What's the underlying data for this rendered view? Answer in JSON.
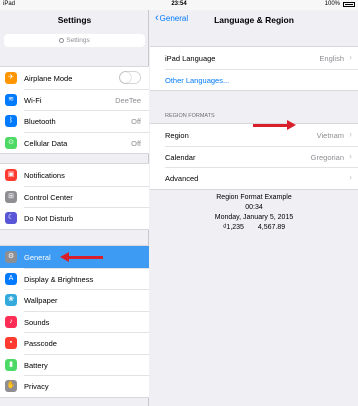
{
  "status": {
    "carrier": "iPad",
    "time": "23:54",
    "battery": "100%"
  },
  "master": {
    "title": "Settings",
    "search_placeholder": "Settings",
    "groups": [
      [
        {
          "label": "Airplane Mode",
          "icon": "airplane-icon",
          "color": "#ff9500",
          "glyph": "✈",
          "value": "",
          "toggle": true
        },
        {
          "label": "Wi-Fi",
          "icon": "wifi-icon",
          "color": "#007aff",
          "glyph": "≋",
          "value": "DeeTee"
        },
        {
          "label": "Bluetooth",
          "icon": "bluetooth-icon",
          "color": "#007aff",
          "glyph": "ᛒ",
          "value": "Off"
        },
        {
          "label": "Cellular Data",
          "icon": "cellular-icon",
          "color": "#4cd964",
          "glyph": "⊙",
          "value": "Off"
        }
      ],
      [
        {
          "label": "Notifications",
          "icon": "notifications-icon",
          "color": "#ff3b30",
          "glyph": "▣",
          "value": ""
        },
        {
          "label": "Control Center",
          "icon": "control-center-icon",
          "color": "#8e8e93",
          "glyph": "⊞",
          "value": ""
        },
        {
          "label": "Do Not Disturb",
          "icon": "moon-icon",
          "color": "#5856d6",
          "glyph": "☾",
          "value": ""
        }
      ],
      [
        {
          "label": "General",
          "icon": "gear-icon",
          "color": "#8e8e93",
          "glyph": "⚙",
          "value": "",
          "selected": true
        },
        {
          "label": "Display & Brightness",
          "icon": "brightness-icon",
          "color": "#007aff",
          "glyph": "A",
          "value": ""
        },
        {
          "label": "Wallpaper",
          "icon": "wallpaper-icon",
          "color": "#34aadc",
          "glyph": "❀",
          "value": ""
        },
        {
          "label": "Sounds",
          "icon": "sounds-icon",
          "color": "#ff2d55",
          "glyph": "♪",
          "value": ""
        },
        {
          "label": "Passcode",
          "icon": "passcode-icon",
          "color": "#ff3b30",
          "glyph": "▪",
          "value": ""
        },
        {
          "label": "Battery",
          "icon": "battery-icon",
          "color": "#4cd964",
          "glyph": "▮",
          "value": ""
        },
        {
          "label": "Privacy",
          "icon": "hand-icon",
          "color": "#8e8e93",
          "glyph": "✋",
          "value": ""
        }
      ]
    ]
  },
  "detail": {
    "back_label": "General",
    "title": "Language & Region",
    "ipad_language_label": "iPad Language",
    "ipad_language_value": "English",
    "other_languages_label": "Other Languages...",
    "region_formats_header": "REGION FORMATS",
    "region_label": "Region",
    "region_value": "Vietnam",
    "calendar_label": "Calendar",
    "calendar_value": "Gregorian",
    "advanced_label": "Advanced",
    "example_title": "Region Format Example",
    "example_time": "00:34",
    "example_date": "Monday, January 5, 2015",
    "example_currency": "₫1,235",
    "example_number": "4,567.89"
  },
  "colors": {
    "accent": "#007aff",
    "selection": "#3d9bf3",
    "annotation_arrow": "#d9202a"
  }
}
